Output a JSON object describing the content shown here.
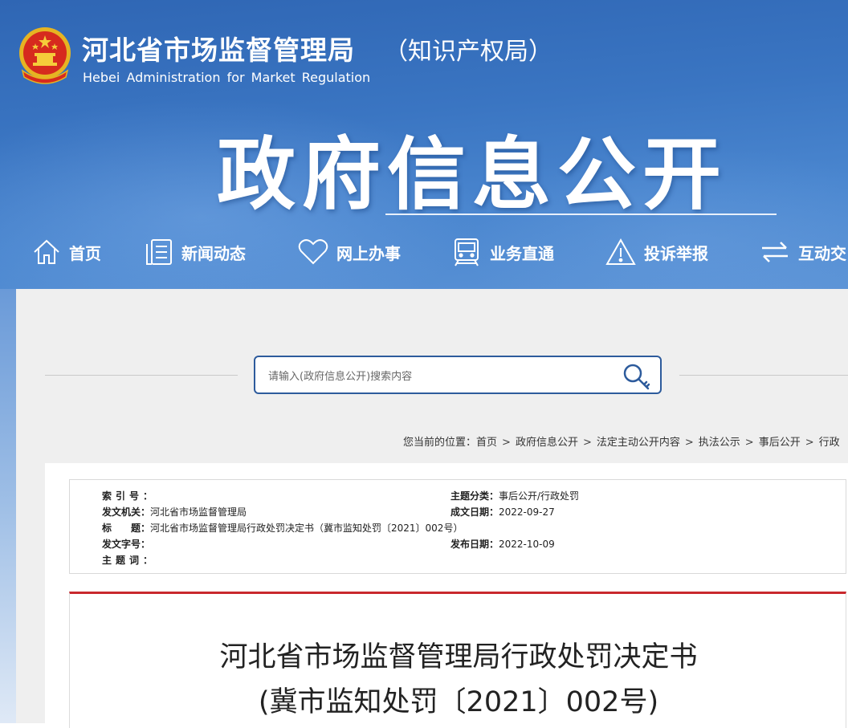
{
  "header": {
    "site_name": "河北省市场监督管理局",
    "site_subname": "（知识产权局）",
    "site_name_en": "Hebei Administration for Market Regulation",
    "banner_title": "政府信息公开"
  },
  "nav": {
    "items": [
      {
        "label": "首页",
        "icon": "home-icon"
      },
      {
        "label": "新闻动态",
        "icon": "news-icon"
      },
      {
        "label": "网上办事",
        "icon": "heart-icon"
      },
      {
        "label": "业务直通",
        "icon": "train-icon"
      },
      {
        "label": "投诉举报",
        "icon": "warning-icon"
      },
      {
        "label": "互动交",
        "icon": "exchange-icon"
      }
    ]
  },
  "search": {
    "placeholder": "请输入(政府信息公开)搜索内容",
    "icon": "search-key-icon"
  },
  "breadcrumb": {
    "prefix": "您当前的位置：",
    "items": [
      "首页",
      "政府信息公开",
      "法定主动公开内容",
      "执法公示",
      "事后公开",
      "行政"
    ]
  },
  "meta": {
    "index_no": {
      "label": "索引号：",
      "value": ""
    },
    "category": {
      "label": "主题分类：",
      "value": "事后公开/行政处罚"
    },
    "issuer": {
      "label": "发文机关：",
      "value": "河北省市场监督管理局"
    },
    "created": {
      "label": "成文日期：",
      "value": "2022-09-27"
    },
    "title": {
      "label": "标　　题：",
      "value": "河北省市场监督管理局行政处罚决定书（冀市监知处罚〔2021〕002号）"
    },
    "doc_no": {
      "label": "发文字号：",
      "value": ""
    },
    "published": {
      "label": "发布日期：",
      "value": "2022-10-09"
    },
    "keywords": {
      "label": "主题词：",
      "value": ""
    }
  },
  "document": {
    "title": "河北省市场监督管理局行政处罚决定书",
    "number": "(冀市监知处罚〔2021〕002号)"
  },
  "colors": {
    "header_blue": "#3a75c2",
    "accent_red": "#c9282d",
    "search_border": "#2d5b9c",
    "panel_gray": "#efefef"
  }
}
